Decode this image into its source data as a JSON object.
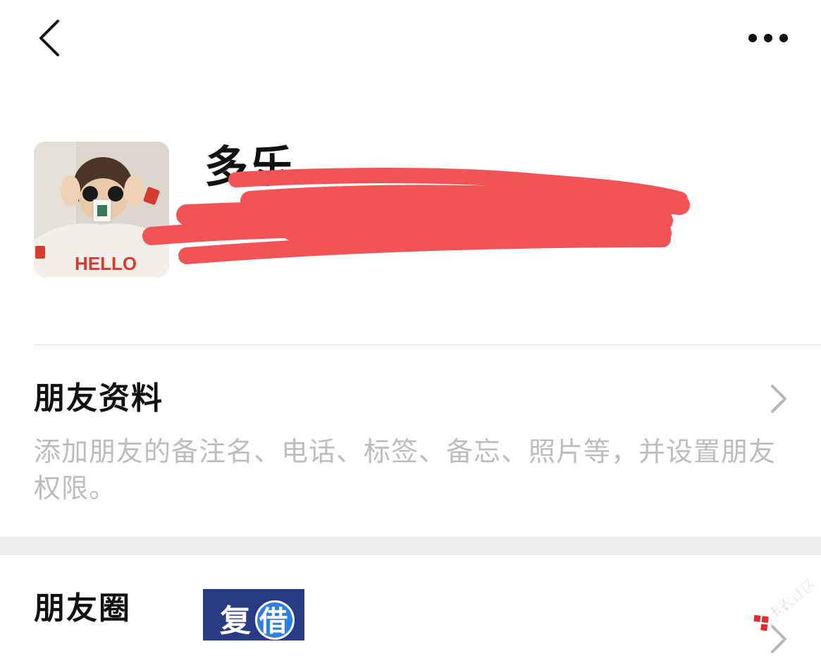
{
  "topbar": {
    "back_icon": "chevron-left-icon",
    "more_icon": "more-horizontal-icon"
  },
  "profile": {
    "name": "多乐",
    "avatar_icon": "avatar-photo",
    "redaction_color": "#f25356"
  },
  "friend_info": {
    "title": "朋友资料",
    "description": "添加朋友的备注名、电话、标签、备忘、照片等，并设置朋友权限。"
  },
  "moments": {
    "title": "朋友圈",
    "thumb_text_1": "复",
    "thumb_text_2": "借"
  },
  "watermark": {
    "text": "卡农社区"
  },
  "colors": {
    "text_primary": "#111111",
    "text_secondary": "#bdbdbd",
    "section_gap": "#ededed",
    "divider": "#e2e2e2",
    "chevron": "#b8b8b8"
  }
}
